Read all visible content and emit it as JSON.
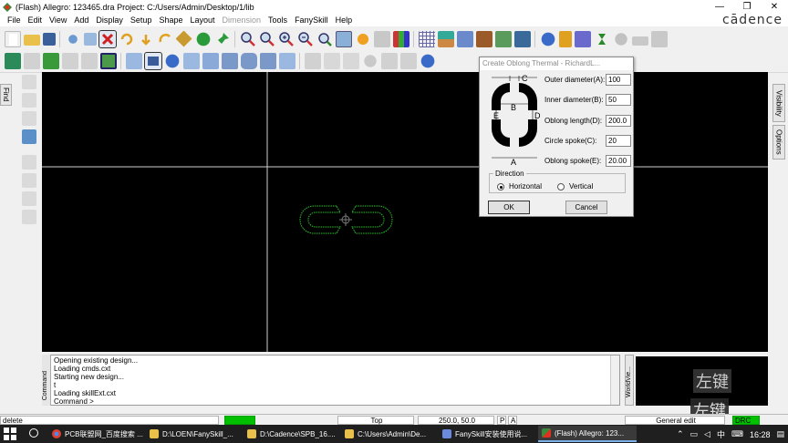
{
  "window": {
    "title": "(Flash) Allegro: 123465.dra  Project: C:/Users/Admin/Desktop/1/lib",
    "minimize": "—",
    "restore": "❐",
    "close": "✕"
  },
  "menu": [
    "File",
    "Edit",
    "View",
    "Add",
    "Display",
    "Setup",
    "Shape",
    "Layout",
    "Dimension",
    "Tools",
    "FanySkill",
    "Help"
  ],
  "menu_disabled": "Dimension",
  "brand": "cādence",
  "left_tabs": {
    "find": "Find"
  },
  "right_tabs": {
    "visibility": "Visibility",
    "options": "Options"
  },
  "dialog": {
    "title": "Create Oblong Thermal - RichardL...",
    "diagram_labels": {
      "a": "A",
      "b": "B",
      "c": "C",
      "d": "D",
      "e": "E"
    },
    "fields": [
      {
        "label": "Outer diameter(A):",
        "value": "100"
      },
      {
        "label": "Inner diameter(B):",
        "value": "50"
      },
      {
        "label": "Oblong length(D):",
        "value": "200.0"
      },
      {
        "label": "Circle spoke(C):",
        "value": "20"
      },
      {
        "label": "Oblong spoke(E):",
        "value": "20.00"
      }
    ],
    "direction_label": "Direction",
    "horizontal": "Horizontal",
    "vertical": "Vertical",
    "selected_direction": "Horizontal",
    "ok": "OK",
    "cancel": "Cancel"
  },
  "command": {
    "lines": [
      "Opening existing design...",
      "Loading cmds.cxt",
      "Starting new design...",
      "t",
      "Loading skillExt.cxt",
      "Command >"
    ],
    "side_label": "Command",
    "worldview_label": "WorldVie..."
  },
  "ime_text": "左键",
  "status": {
    "command": "delete",
    "layer": "Top",
    "coords": "250.0, 50.0",
    "p": "P",
    "a": "A",
    "mode": "General edit",
    "drc": "DRC"
  },
  "taskbar": {
    "tasks": [
      "PCB联盟网_百度搜索 ...",
      "D:\\LOEN\\FanySkill_...",
      "D:\\Cadence\\SPB_16....",
      "C:\\Users\\Admin\\De...",
      "FanySkill安装使用说...",
      "(Flash) Allegro: 123..."
    ],
    "tray": {
      "ime": "中",
      "time": "16:28"
    }
  },
  "colors": {
    "canvas": "#000000",
    "crosshair": "#d0d0d0",
    "shape": "#2bc42b",
    "status_green": "#00c000"
  }
}
